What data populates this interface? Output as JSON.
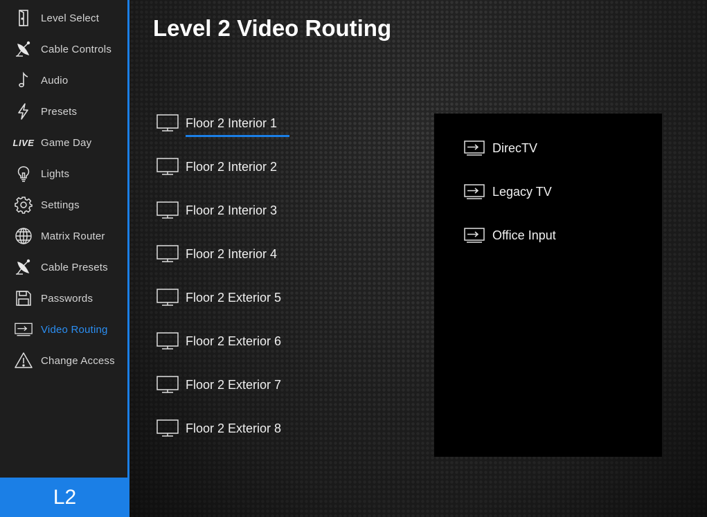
{
  "sidebar": {
    "items": [
      {
        "label": "Level Select",
        "icon": "door-icon"
      },
      {
        "label": "Cable Controls",
        "icon": "satellite-dish-icon"
      },
      {
        "label": "Audio",
        "icon": "music-note-icon"
      },
      {
        "label": "Presets",
        "icon": "lightning-icon"
      },
      {
        "label": "Game Day",
        "icon": "live-icon",
        "icon_text": "LIVE"
      },
      {
        "label": "Lights",
        "icon": "lightbulb-icon"
      },
      {
        "label": "Settings",
        "icon": "gear-icon"
      },
      {
        "label": "Matrix Router",
        "icon": "globe-icon"
      },
      {
        "label": "Cable Presets",
        "icon": "satellite-dish-icon"
      },
      {
        "label": "Passwords",
        "icon": "floppy-disk-icon"
      },
      {
        "label": "Video Routing",
        "icon": "input-arrow-icon",
        "active": true
      },
      {
        "label": "Change Access",
        "icon": "warning-icon"
      }
    ],
    "level_badge": "L2"
  },
  "main": {
    "title": "Level 2 Video Routing",
    "outputs": [
      {
        "label": "Floor 2 Interior 1",
        "selected": true
      },
      {
        "label": "Floor 2 Interior 2"
      },
      {
        "label": "Floor 2 Interior 3"
      },
      {
        "label": "Floor 2 Interior 4"
      },
      {
        "label": "Floor 2 Exterior 5"
      },
      {
        "label": "Floor 2 Exterior 6"
      },
      {
        "label": "Floor 2 Exterior 7"
      },
      {
        "label": "Floor 2 Exterior 8"
      }
    ],
    "sources": [
      {
        "label": "DirecTV"
      },
      {
        "label": "Legacy TV"
      },
      {
        "label": "Office Input"
      }
    ]
  },
  "colors": {
    "accent": "#1b7fe6",
    "active_text": "#2b8ef2",
    "sidebar_bg": "#1e1e1e",
    "panel_bg": "#000000"
  }
}
